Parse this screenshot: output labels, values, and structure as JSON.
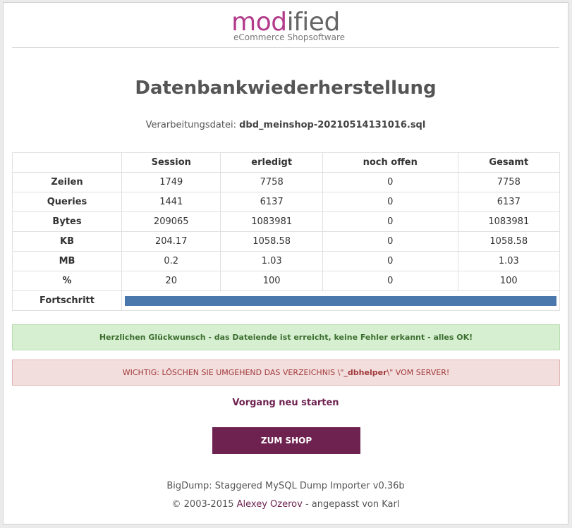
{
  "logo": {
    "word_part1": "mod",
    "word_part2": "ified",
    "tagline": "eCommerce Shopsoftware",
    "accent_color": "#b23a8a"
  },
  "page_title": "Datenbankwiederherstellung",
  "file": {
    "label": "Verarbeitungsdatei:",
    "name": "dbd_meinshop-20210514131016.sql"
  },
  "table": {
    "headers": [
      "",
      "Session",
      "erledigt",
      "noch offen",
      "Gesamt"
    ],
    "rows": [
      {
        "label": "Zeilen",
        "values": [
          "1749",
          "7758",
          "0",
          "7758"
        ]
      },
      {
        "label": "Queries",
        "values": [
          "1441",
          "6137",
          "0",
          "6137"
        ]
      },
      {
        "label": "Bytes",
        "values": [
          "209065",
          "1083981",
          "0",
          "1083981"
        ]
      },
      {
        "label": "KB",
        "values": [
          "204.17",
          "1058.58",
          "0",
          "1058.58"
        ]
      },
      {
        "label": "MB",
        "values": [
          "0.2",
          "1.03",
          "0",
          "1.03"
        ]
      },
      {
        "label": "%",
        "values": [
          "20",
          "100",
          "0",
          "100"
        ]
      }
    ],
    "progress_label": "Fortschritt",
    "progress_percent": 100,
    "progress_color": "#4a78ad"
  },
  "alerts": {
    "success": "Herzlichen Glückwunsch - das Dateiende ist erreicht, keine Fehler erkannt - alles OK!",
    "warning_prefix": "WICHTIG: LÖSCHEN SIE UMGEHEND DAS VERZEICHNIS \\\"",
    "warning_dir": "_dbhelper",
    "warning_suffix": "\\\" VOM SERVER!"
  },
  "restart_link": "Vorgang neu starten",
  "shop_button": "ZUM SHOP",
  "brand_color": "#6e2250",
  "footer": {
    "line1": "BigDump: Staggered MySQL Dump Importer v0.36b",
    "copyright": "© 2003-2015",
    "author": "Alexey Ozerov",
    "suffix": "- angepasst von Karl"
  }
}
